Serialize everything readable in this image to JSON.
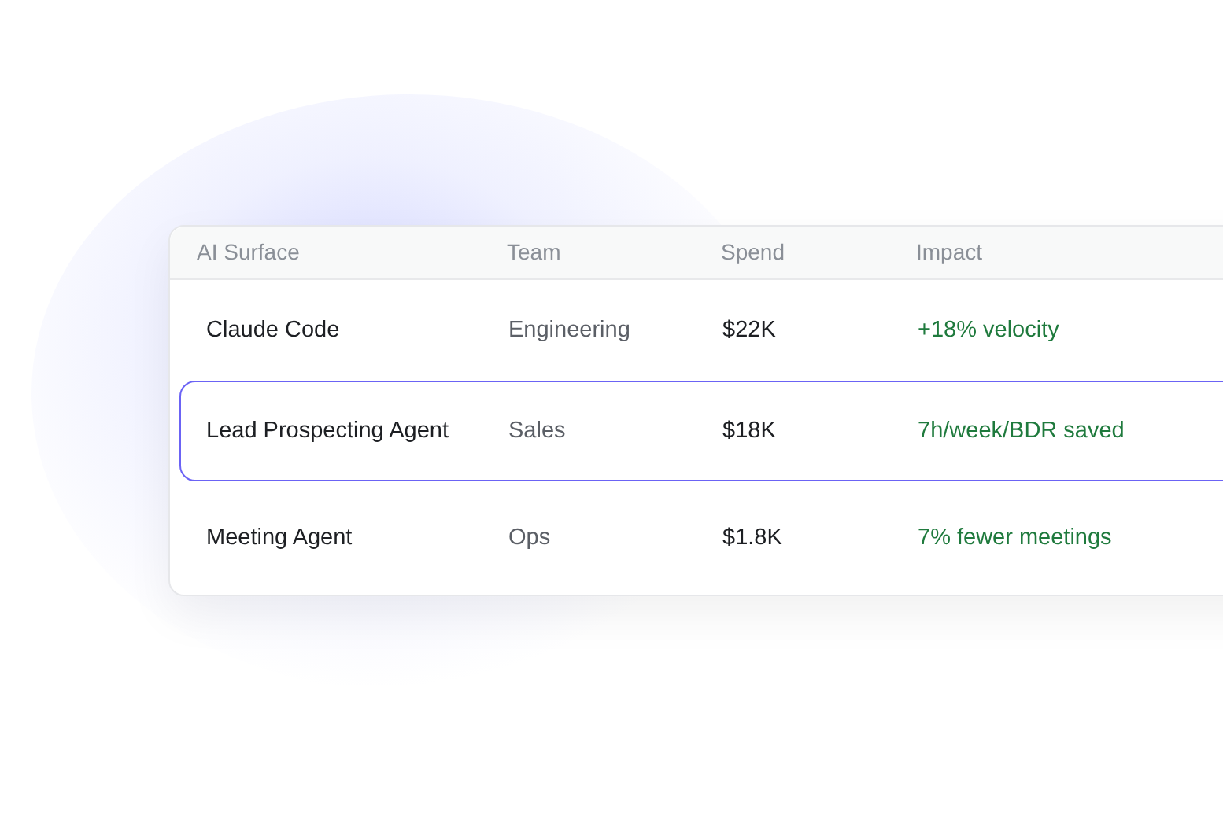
{
  "table": {
    "columns": [
      "AI Surface",
      "Team",
      "Spend",
      "Impact"
    ],
    "rows": [
      {
        "surface": "Claude Code",
        "team": "Engineering",
        "spend": "$22K",
        "impact": "+18% velocity",
        "selected": false
      },
      {
        "surface": "Lead Prospecting Agent",
        "team": "Sales",
        "spend": "$18K",
        "impact": "7h/week/BDR saved",
        "selected": true
      },
      {
        "surface": "Meeting Agent",
        "team": "Ops",
        "spend": "$1.8K",
        "impact": "7% fewer meetings",
        "selected": false
      }
    ]
  }
}
